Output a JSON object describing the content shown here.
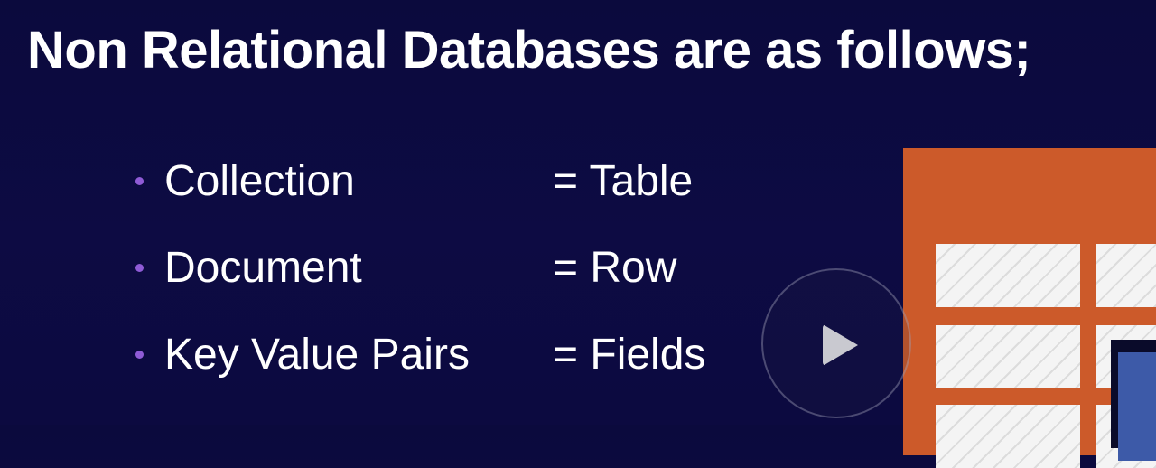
{
  "slide": {
    "title": "Non Relational Databases are as follows;",
    "bullets": [
      {
        "term": "Collection",
        "equivalent": "= Table"
      },
      {
        "term": "Document",
        "equivalent": "= Row"
      },
      {
        "term": "Key Value Pairs",
        "equivalent": "= Fields"
      }
    ]
  },
  "video": {
    "play_icon": "play-icon"
  },
  "colors": {
    "background": "#0c0a40",
    "bullet_dot": "#8f5bd6",
    "table_frame": "#cc5a2a",
    "table_cell": "#f3f3f3",
    "card_blue": "#3d5aa8"
  }
}
